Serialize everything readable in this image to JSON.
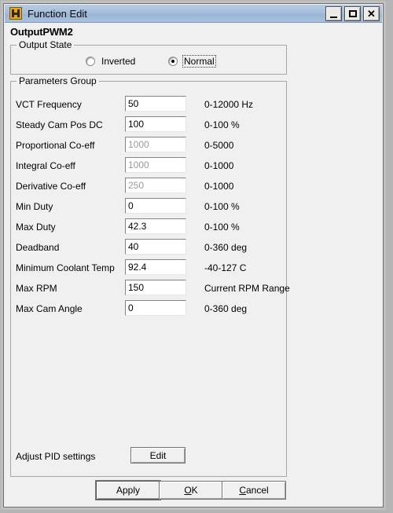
{
  "window": {
    "title": "Function Edit",
    "icon": "h-app-icon",
    "controls": [
      {
        "name": "minimize",
        "glyph": "_"
      },
      {
        "name": "maximize",
        "glyph": "□"
      },
      {
        "name": "close",
        "glyph": "✕"
      }
    ],
    "heading": "OutputPWM2",
    "titlebar_color": "#a7bfdc",
    "face_color": "#f0f0f0",
    "icon_color": "#e8a317"
  },
  "output_state": {
    "group_title": "Output State",
    "options": [
      {
        "label": "Inverted",
        "checked": false,
        "focused": false
      },
      {
        "label": "Normal",
        "checked": true,
        "focused": true
      }
    ]
  },
  "parameters": {
    "group_title": "Parameters Group",
    "rows": [
      {
        "label": "VCT Frequency",
        "value": "50",
        "hint": "0-12000 Hz",
        "enabled": true
      },
      {
        "label": "Steady Cam Pos DC",
        "value": "100",
        "hint": "0-100 %",
        "enabled": true
      },
      {
        "label": "Proportional Co-eff",
        "value": "1000",
        "hint": "0-5000",
        "enabled": false
      },
      {
        "label": "Integral Co-eff",
        "value": "1000",
        "hint": "0-1000",
        "enabled": false
      },
      {
        "label": "Derivative Co-eff",
        "value": "250",
        "hint": "0-1000",
        "enabled": false
      },
      {
        "label": "Min Duty",
        "value": "0",
        "hint": "0-100 %",
        "enabled": true
      },
      {
        "label": "Max Duty",
        "value": "42.3",
        "hint": "0-100 %",
        "enabled": true
      },
      {
        "label": "Deadband",
        "value": "40",
        "hint": "0-360 deg",
        "enabled": true
      },
      {
        "label": "Minimum Coolant Temp",
        "value": "92.4",
        "hint": "-40-127 C",
        "enabled": true
      },
      {
        "label": "Max RPM",
        "value": "150",
        "hint": "Current RPM Range",
        "enabled": true
      },
      {
        "label": "Max Cam Angle",
        "value": "0",
        "hint": "0-360 deg",
        "enabled": true
      }
    ],
    "pid": {
      "label": "Adjust PID settings",
      "button_label": "Edit"
    }
  },
  "dialog_buttons": [
    {
      "name": "apply",
      "label": "Apply",
      "accel": "",
      "default": true
    },
    {
      "name": "ok",
      "label": "OK",
      "accel": "O",
      "default": false
    },
    {
      "name": "cancel",
      "label": "Cancel",
      "accel": "C",
      "default": false
    }
  ]
}
